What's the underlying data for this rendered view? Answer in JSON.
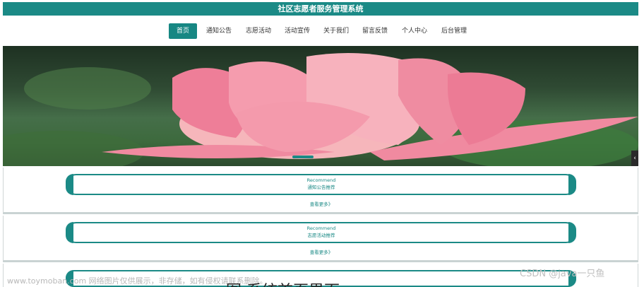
{
  "header": {
    "title": "社区志愿者服务管理系统"
  },
  "nav": {
    "items": [
      {
        "label": "首页"
      },
      {
        "label": "通知公告"
      },
      {
        "label": "志愿活动"
      },
      {
        "label": "活动宣传"
      },
      {
        "label": "关于我们"
      },
      {
        "label": "留言反馈"
      },
      {
        "label": "个人中心"
      },
      {
        "label": "后台管理"
      }
    ],
    "active": "首页",
    "accent": "#178783"
  },
  "banner": {
    "image": "pink-lotus-flower"
  },
  "sections": [
    {
      "en": "Recommend",
      "zh": "通知公告推荐",
      "more": "查看更多》"
    },
    {
      "en": "Recommend",
      "zh": "志愿活动推荐",
      "more": "查看更多》"
    }
  ],
  "watermarks": {
    "left": "www.toymoban.com 网络图片仅供展示，非存储，如有侵权请联系删除。",
    "right": "CSDN @java一只鱼"
  },
  "caption": "图 系统首页界面"
}
